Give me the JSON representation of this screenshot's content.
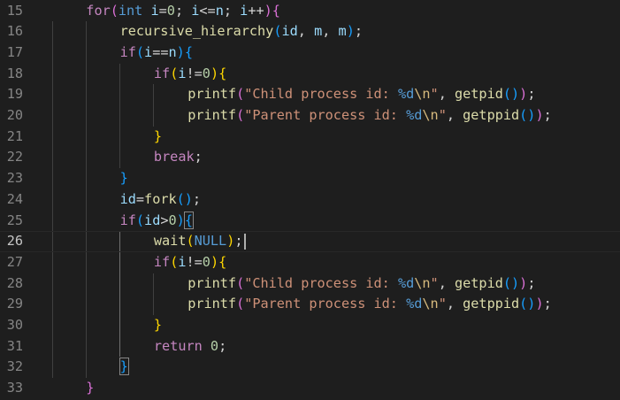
{
  "colors": {
    "background": "#1e1e1e",
    "line_number": "#858585",
    "active_line_number": "#c6c6c6",
    "keyword_control": "#c586c0",
    "keyword_type": "#569cd6",
    "function": "#dcdcaa",
    "variable": "#9cdcfe",
    "number": "#b5cea8",
    "string": "#ce9178",
    "escape": "#d7ba7d",
    "format_spec": "#9cdcfe",
    "bracket_1": "#ffd700",
    "bracket_2": "#da70d6",
    "bracket_3": "#179fff",
    "text": "#d4d4d4"
  },
  "editor": {
    "active_line": 26,
    "lines": [
      {
        "num": "15",
        "tokens": [
          {
            "t": "for",
            "c": "keyword_control"
          },
          {
            "t": "(",
            "c": "bracket_2"
          },
          {
            "t": "int",
            "c": "keyword_type"
          },
          {
            "t": " ",
            "c": "text"
          },
          {
            "t": "i",
            "c": "variable"
          },
          {
            "t": "=",
            "c": "text"
          },
          {
            "t": "0",
            "c": "number"
          },
          {
            "t": "; ",
            "c": "text"
          },
          {
            "t": "i",
            "c": "variable"
          },
          {
            "t": "<=",
            "c": "text"
          },
          {
            "t": "n",
            "c": "variable"
          },
          {
            "t": "; ",
            "c": "text"
          },
          {
            "t": "i",
            "c": "variable"
          },
          {
            "t": "++",
            "c": "text"
          },
          {
            "t": ")",
            "c": "bracket_2"
          },
          {
            "t": "{",
            "c": "bracket_2"
          }
        ]
      },
      {
        "num": "16",
        "tokens": [
          {
            "t": "recursive_hierarchy",
            "c": "function"
          },
          {
            "t": "(",
            "c": "bracket_3"
          },
          {
            "t": "id",
            "c": "variable"
          },
          {
            "t": ", ",
            "c": "text"
          },
          {
            "t": "m",
            "c": "variable"
          },
          {
            "t": ", ",
            "c": "text"
          },
          {
            "t": "m",
            "c": "variable"
          },
          {
            "t": ")",
            "c": "bracket_3"
          },
          {
            "t": ";",
            "c": "text"
          }
        ]
      },
      {
        "num": "17",
        "tokens": [
          {
            "t": "if",
            "c": "keyword_control"
          },
          {
            "t": "(",
            "c": "bracket_3"
          },
          {
            "t": "i",
            "c": "variable"
          },
          {
            "t": "==",
            "c": "text"
          },
          {
            "t": "n",
            "c": "variable"
          },
          {
            "t": ")",
            "c": "bracket_3"
          },
          {
            "t": "{",
            "c": "bracket_3"
          }
        ]
      },
      {
        "num": "18",
        "tokens": [
          {
            "t": "if",
            "c": "keyword_control"
          },
          {
            "t": "(",
            "c": "bracket_1"
          },
          {
            "t": "i",
            "c": "variable"
          },
          {
            "t": "!=",
            "c": "text"
          },
          {
            "t": "0",
            "c": "number"
          },
          {
            "t": ")",
            "c": "bracket_1"
          },
          {
            "t": "{",
            "c": "bracket_1"
          }
        ]
      },
      {
        "num": "19",
        "tokens": [
          {
            "t": "printf",
            "c": "function"
          },
          {
            "t": "(",
            "c": "bracket_2"
          },
          {
            "t": "\"Child process id: ",
            "c": "string"
          },
          {
            "t": "%d",
            "c": "keyword_type"
          },
          {
            "t": "\\n",
            "c": "escape"
          },
          {
            "t": "\"",
            "c": "string"
          },
          {
            "t": ", ",
            "c": "text"
          },
          {
            "t": "getpid",
            "c": "function"
          },
          {
            "t": "()",
            "c": "bracket_3"
          },
          {
            "t": ")",
            "c": "bracket_2"
          },
          {
            "t": ";",
            "c": "text"
          }
        ]
      },
      {
        "num": "20",
        "tokens": [
          {
            "t": "printf",
            "c": "function"
          },
          {
            "t": "(",
            "c": "bracket_2"
          },
          {
            "t": "\"Parent process id: ",
            "c": "string"
          },
          {
            "t": "%d",
            "c": "keyword_type"
          },
          {
            "t": "\\n",
            "c": "escape"
          },
          {
            "t": "\"",
            "c": "string"
          },
          {
            "t": ", ",
            "c": "text"
          },
          {
            "t": "getppid",
            "c": "function"
          },
          {
            "t": "()",
            "c": "bracket_3"
          },
          {
            "t": ")",
            "c": "bracket_2"
          },
          {
            "t": ";",
            "c": "text"
          }
        ]
      },
      {
        "num": "21",
        "tokens": [
          {
            "t": "}",
            "c": "bracket_1"
          }
        ]
      },
      {
        "num": "22",
        "tokens": [
          {
            "t": "break",
            "c": "keyword_control"
          },
          {
            "t": ";",
            "c": "text"
          }
        ]
      },
      {
        "num": "23",
        "tokens": [
          {
            "t": "}",
            "c": "bracket_3"
          }
        ]
      },
      {
        "num": "24",
        "tokens": [
          {
            "t": "id",
            "c": "variable"
          },
          {
            "t": "=",
            "c": "text"
          },
          {
            "t": "fork",
            "c": "function"
          },
          {
            "t": "()",
            "c": "bracket_3"
          },
          {
            "t": ";",
            "c": "text"
          }
        ]
      },
      {
        "num": "25",
        "tokens": [
          {
            "t": "if",
            "c": "keyword_control"
          },
          {
            "t": "(",
            "c": "bracket_3"
          },
          {
            "t": "id",
            "c": "variable"
          },
          {
            "t": ">",
            "c": "text"
          },
          {
            "t": "0",
            "c": "number"
          },
          {
            "t": ")",
            "c": "bracket_3"
          },
          {
            "t": "{",
            "c": "bracket_3",
            "boxed": true
          }
        ]
      },
      {
        "num": "26",
        "tokens": [
          {
            "t": "wait",
            "c": "function"
          },
          {
            "t": "(",
            "c": "bracket_1"
          },
          {
            "t": "NULL",
            "c": "keyword_type"
          },
          {
            "t": ")",
            "c": "bracket_1"
          },
          {
            "t": ";",
            "c": "text"
          }
        ]
      },
      {
        "num": "27",
        "tokens": [
          {
            "t": "if",
            "c": "keyword_control"
          },
          {
            "t": "(",
            "c": "bracket_1"
          },
          {
            "t": "i",
            "c": "variable"
          },
          {
            "t": "!=",
            "c": "text"
          },
          {
            "t": "0",
            "c": "number"
          },
          {
            "t": ")",
            "c": "bracket_1"
          },
          {
            "t": "{",
            "c": "bracket_1"
          }
        ]
      },
      {
        "num": "28",
        "tokens": [
          {
            "t": "printf",
            "c": "function"
          },
          {
            "t": "(",
            "c": "bracket_2"
          },
          {
            "t": "\"Child process id: ",
            "c": "string"
          },
          {
            "t": "%d",
            "c": "keyword_type"
          },
          {
            "t": "\\n",
            "c": "escape"
          },
          {
            "t": "\"",
            "c": "string"
          },
          {
            "t": ", ",
            "c": "text"
          },
          {
            "t": "getpid",
            "c": "function"
          },
          {
            "t": "()",
            "c": "bracket_3"
          },
          {
            "t": ")",
            "c": "bracket_2"
          },
          {
            "t": ";",
            "c": "text"
          }
        ]
      },
      {
        "num": "29",
        "tokens": [
          {
            "t": "printf",
            "c": "function"
          },
          {
            "t": "(",
            "c": "bracket_2"
          },
          {
            "t": "\"Parent process id: ",
            "c": "string"
          },
          {
            "t": "%d",
            "c": "keyword_type"
          },
          {
            "t": "\\n",
            "c": "escape"
          },
          {
            "t": "\"",
            "c": "string"
          },
          {
            "t": ", ",
            "c": "text"
          },
          {
            "t": "getppid",
            "c": "function"
          },
          {
            "t": "()",
            "c": "bracket_3"
          },
          {
            "t": ")",
            "c": "bracket_2"
          },
          {
            "t": ";",
            "c": "text"
          }
        ]
      },
      {
        "num": "30",
        "tokens": [
          {
            "t": "}",
            "c": "bracket_1"
          }
        ]
      },
      {
        "num": "31",
        "tokens": [
          {
            "t": "return",
            "c": "keyword_control"
          },
          {
            "t": " ",
            "c": "text"
          },
          {
            "t": "0",
            "c": "number"
          },
          {
            "t": ";",
            "c": "text"
          }
        ]
      },
      {
        "num": "32",
        "tokens": [
          {
            "t": "}",
            "c": "bracket_3",
            "boxed": true
          }
        ]
      },
      {
        "num": "33",
        "tokens": [
          {
            "t": "}",
            "c": "bracket_2"
          }
        ]
      }
    ]
  }
}
